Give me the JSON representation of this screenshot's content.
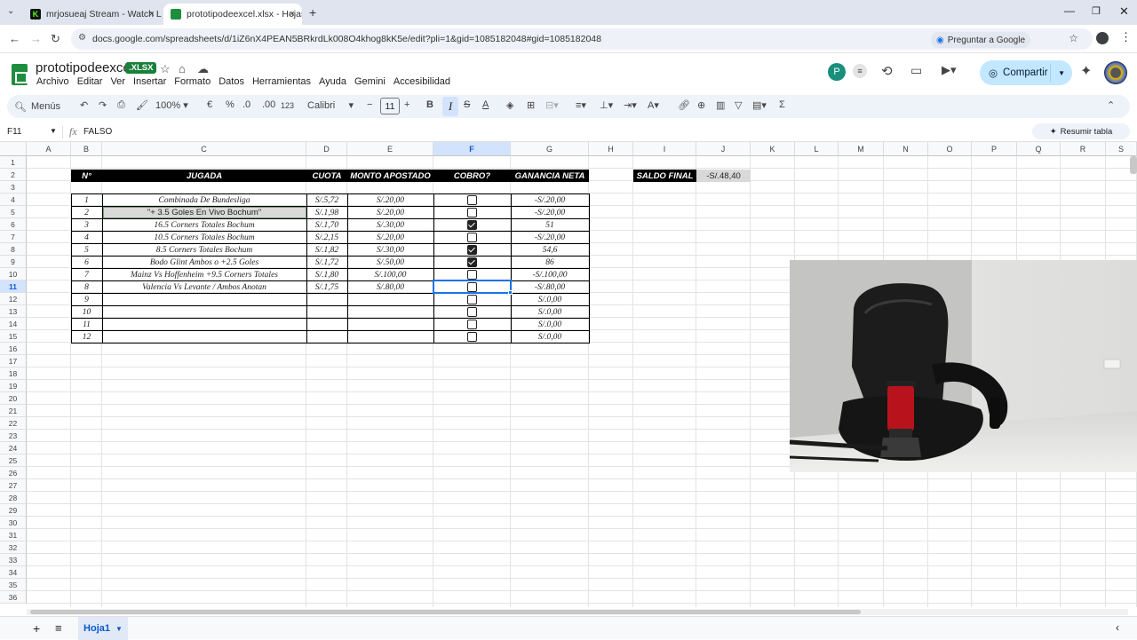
{
  "browser": {
    "tabs": [
      {
        "title": "mrjosueaj Stream - Watch Live",
        "close": "×"
      },
      {
        "title": "prototipodeexcel.xlsx - Hojas de",
        "close": "×"
      }
    ],
    "new_tab": "+",
    "url": "docs.google.com/spreadsheets/d/1iZ6nX4PEAN5BRkrdLk008O4khog8kK5e/edit?pli=1&gid=1085182048#gid=1085182048",
    "ask_google": "Preguntar a Google"
  },
  "doc": {
    "title": "prototipodeexcel",
    "badge": ".XLSX",
    "avatar_letter": "P",
    "share_label": "Compartir",
    "menus": [
      "Archivo",
      "Editar",
      "Ver",
      "Insertar",
      "Formato",
      "Datos",
      "Herramientas",
      "Ayuda",
      "Gemini",
      "Accesibilidad"
    ]
  },
  "toolbar": {
    "menus_label": "Menús",
    "zoom": "100%",
    "currency": "€",
    "percent": "%",
    "dec_decrease": ".0",
    "dec_increase": ".00",
    "number_format": "123",
    "font": "Calibri",
    "font_size": "11",
    "bold": "B",
    "italic": "I",
    "strike": "S",
    "text_color": "A",
    "sum": "Σ"
  },
  "formula_bar": {
    "name_box": "F11",
    "fx": "fx",
    "value": "FALSO",
    "summarize": "Resumir tabla"
  },
  "grid": {
    "columns": [
      "A",
      "B",
      "C",
      "D",
      "E",
      "F",
      "G",
      "H",
      "I",
      "J",
      "K",
      "L",
      "M",
      "N",
      "O",
      "P",
      "Q",
      "R",
      "S"
    ],
    "rows": [
      "1",
      "2",
      "3",
      "4",
      "5",
      "6",
      "7",
      "8",
      "9",
      "10",
      "11",
      "12",
      "13",
      "14",
      "15",
      "16",
      "17",
      "18",
      "19",
      "20",
      "21",
      "22",
      "23",
      "24",
      "25",
      "26",
      "27",
      "28",
      "29",
      "30",
      "31",
      "32",
      "33",
      "34",
      "35",
      "36"
    ],
    "selected_column": "F",
    "selected_row": "11"
  },
  "table": {
    "headers": [
      "N°",
      "JUGADA",
      "CUOTA",
      "MONTO APOSTADO",
      "COBRO?",
      "GANANCIA NETA"
    ],
    "rows": [
      {
        "n": "1",
        "jugada": "Combinada De Bundesliga",
        "cuota": "S/.5,72",
        "monto": "S/.20,00",
        "cobro": false,
        "ganancia": "-S/.20,00"
      },
      {
        "n": "2",
        "jugada": "\"+ 3.5 Goles En Vivo Bochum\"",
        "cuota": "S/.1,98",
        "monto": "S/.20,00",
        "cobro": false,
        "ganancia": "-S/.20,00"
      },
      {
        "n": "3",
        "jugada": "16.5 Corners Totales Bochum",
        "cuota": "S/.1,70",
        "monto": "S/.30,00",
        "cobro": true,
        "ganancia": "51"
      },
      {
        "n": "4",
        "jugada": "10.5 Corners Totales Bochum",
        "cuota": "S/.2,15",
        "monto": "S/.20,00",
        "cobro": false,
        "ganancia": "-S/.20,00"
      },
      {
        "n": "5",
        "jugada": "8.5 Corners Totales Bochum",
        "cuota": "S/.1,82",
        "monto": "S/.30,00",
        "cobro": true,
        "ganancia": "54,6"
      },
      {
        "n": "6",
        "jugada": "Bodo Glint Ambos o +2.5 Goles",
        "cuota": "S/.1,72",
        "monto": "S/.50,00",
        "cobro": true,
        "ganancia": "86"
      },
      {
        "n": "7",
        "jugada": "Mainz Vs Hoffenheim +9.5 Corners Totales",
        "cuota": "S/.1,80",
        "monto": "S/.100,00",
        "cobro": false,
        "ganancia": "-S/.100,00"
      },
      {
        "n": "8",
        "jugada": "Valencia Vs Levante / Ambos Anotan",
        "cuota": "S/.1,75",
        "monto": "S/.80,00",
        "cobro": false,
        "ganancia": "-S/.80,00"
      },
      {
        "n": "9",
        "jugada": "",
        "cuota": "",
        "monto": "",
        "cobro": false,
        "ganancia": "S/.0,00"
      },
      {
        "n": "10",
        "jugada": "",
        "cuota": "",
        "monto": "",
        "cobro": false,
        "ganancia": "S/.0,00"
      },
      {
        "n": "11",
        "jugada": "",
        "cuota": "",
        "monto": "",
        "cobro": false,
        "ganancia": "S/.0,00"
      },
      {
        "n": "12",
        "jugada": "",
        "cuota": "",
        "monto": "",
        "cobro": false,
        "ganancia": "S/.0,00"
      }
    ]
  },
  "saldo": {
    "label": "SALDO FINAL",
    "value": "-S/.48,40"
  },
  "bottom": {
    "add": "+",
    "list": "≡",
    "sheet": "Hoja1"
  },
  "colors": {
    "accent": "#1a73e8",
    "share_bg": "#c2e7ff",
    "xlsx": "#188038",
    "header_black": "#000000",
    "saldo_value_bg": "#d9d9d9",
    "highlight_row": "#d9d9d9"
  }
}
